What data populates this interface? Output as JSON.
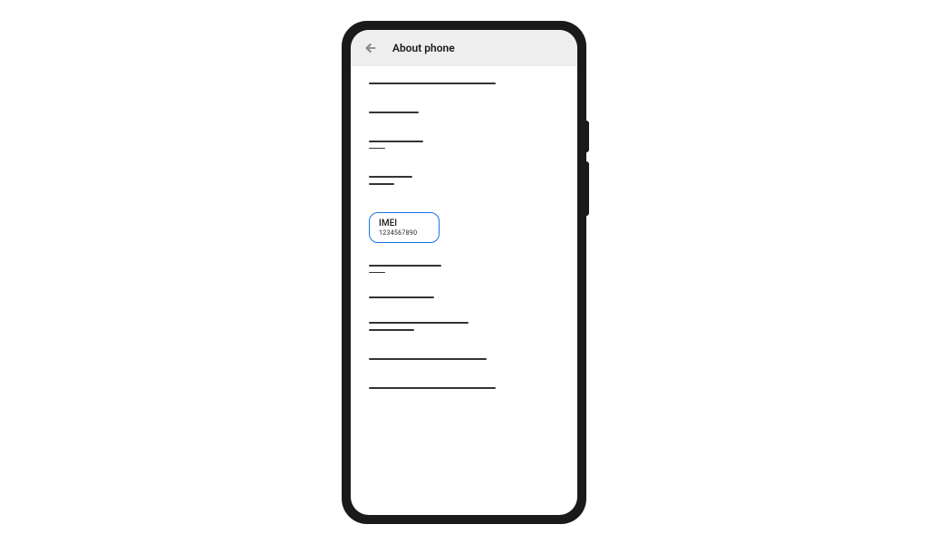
{
  "header": {
    "title": "About phone"
  },
  "imei": {
    "label": "IMEI",
    "value": "1234567890"
  }
}
